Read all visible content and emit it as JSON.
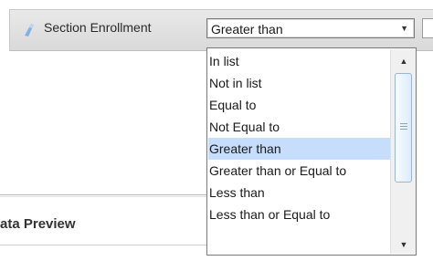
{
  "filter": {
    "field_icon": "filter-field-icon",
    "field_label": "Section Enrollment",
    "operator_selected": "Greater than",
    "operator_options": [
      "In list",
      "Not in list",
      "Equal to",
      "Not Equal to",
      "Greater than",
      "Greater than or Equal to",
      "Less than",
      "Less than or Equal to"
    ]
  },
  "preview": {
    "title": "ata Preview"
  },
  "colors": {
    "selected_option_bg": "#c6defb",
    "field_icon": "#7fb2e5"
  }
}
